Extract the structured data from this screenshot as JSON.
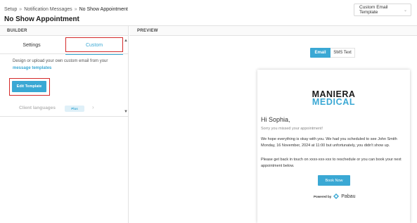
{
  "header": {
    "breadcrumb": {
      "root": "Setup",
      "parent": "Notification Messages",
      "current": "No Show Appointment",
      "separator": "»"
    },
    "title": "No Show Appointment",
    "template_select": {
      "value": "Custom Email Template",
      "icon": "chevron-down-icon"
    }
  },
  "builder": {
    "heading": "BUILDER",
    "tabs": [
      {
        "label": "Settings"
      },
      {
        "label": "Custom"
      }
    ],
    "description": "Design or upload your own custom email from your",
    "description_link": "message templates",
    "edit_button": "Edit Template",
    "client_languages": {
      "label": "Client languages",
      "badge": "Plus",
      "icon": "chevron-right-icon"
    },
    "scroll_icons": {
      "up": "triangle-up-icon",
      "down": "triangle-down-icon"
    }
  },
  "preview": {
    "heading": "PREVIEW",
    "toggle": {
      "email": "Email",
      "sms": "SMS Text",
      "selected": "Email"
    },
    "email": {
      "logo": {
        "line1": "MANIERA",
        "line2": "MEDICAL"
      },
      "greeting": "Hi Sophia,",
      "subtitle": "Sorry you missed your appointment!",
      "paragraph1": "We hope everything is okay with you. We had you scheduled to see John Smith Monday, 16 November, 2024 at 11:00 but unfortunately, you didn't show up.",
      "paragraph2": "Please get back in touch on xxxx-xxx-xxx to reschedule or you can book your next appointment below.",
      "button": "Book Now",
      "powered_by": "Powered by",
      "brand": "Pabau"
    }
  },
  "colors": {
    "accent": "#3aa8d4",
    "highlight_box": "#d42a2a"
  }
}
